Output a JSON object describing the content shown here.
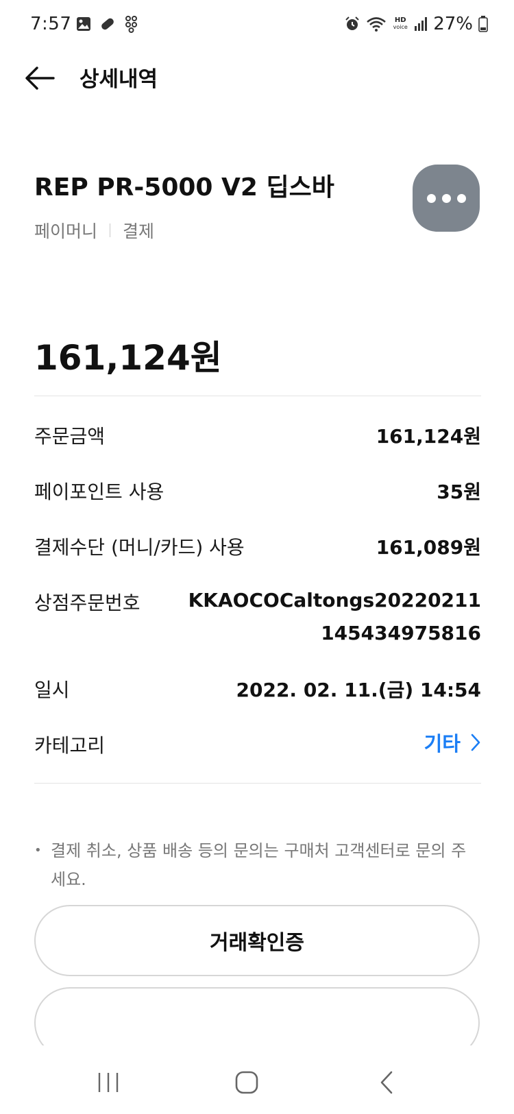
{
  "status_bar": {
    "time": "7:57",
    "battery": "27%",
    "hd_voice_top": "HD",
    "hd_voice_bottom": "voice"
  },
  "header": {
    "title": "상세내역"
  },
  "product": {
    "title": "REP PR-5000 V2 딥스바",
    "service": "페이머니",
    "type": "결제"
  },
  "total_amount": "161,124원",
  "details": {
    "order_amount_label": "주문금액",
    "order_amount_value": "161,124원",
    "paypoint_label": "페이포인트 사용",
    "paypoint_value": "35원",
    "method_label": "결제수단 (머니/카드) 사용",
    "method_value": "161,089원",
    "order_no_label": "상점주문번호",
    "order_no_value": "KKAOCOCaltongs20220211145434975816",
    "date_label": "일시",
    "date_value": "2022. 02. 11.(금) 14:54",
    "category_label": "카테고리",
    "category_value": "기타"
  },
  "notice": "결제 취소, 상품 배송 등의 문의는 구매처 고객센터로 문의 주세요.",
  "buttons": {
    "confirm_label": "거래확인증"
  },
  "colors": {
    "accent": "#1b7ef5",
    "more_button": "#7d858e"
  }
}
